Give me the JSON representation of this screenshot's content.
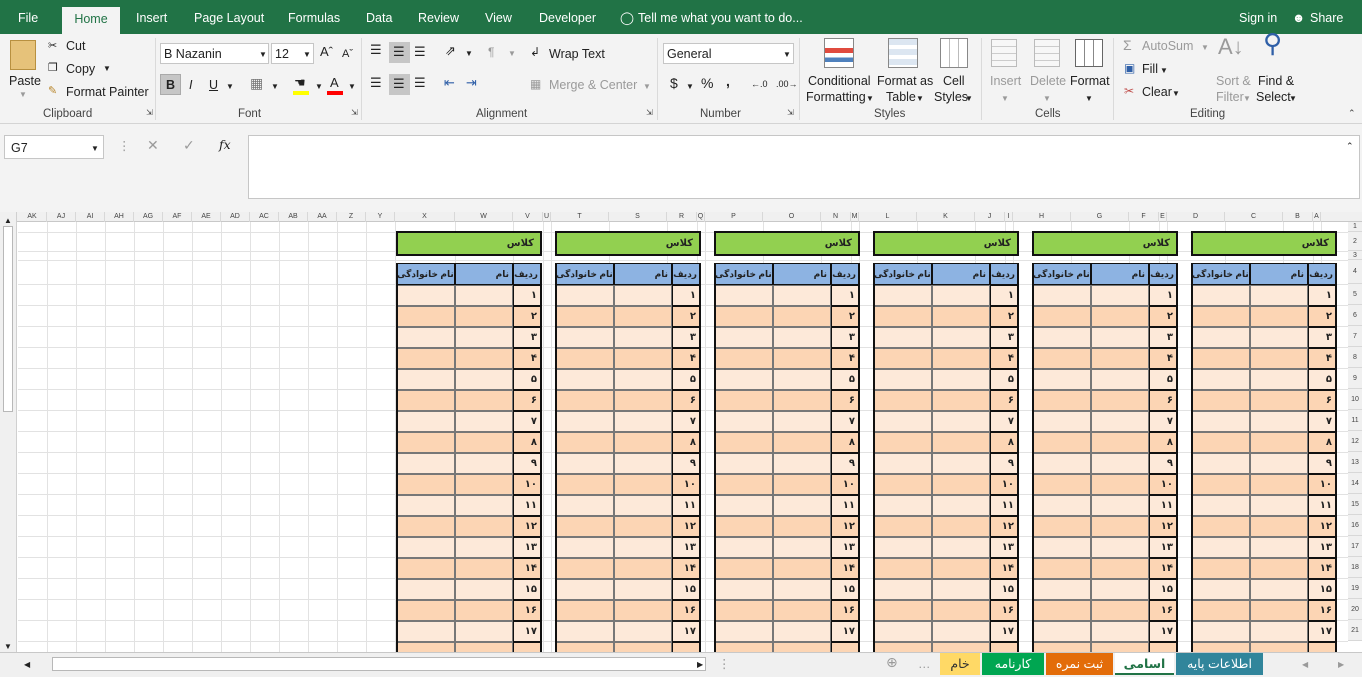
{
  "tabs": [
    "File",
    "Home",
    "Insert",
    "Page Layout",
    "Formulas",
    "Data",
    "Review",
    "View",
    "Developer"
  ],
  "tell_me": "Tell me what you want to do...",
  "signin": "Sign in",
  "share": "Share",
  "clipboard": {
    "paste": "Paste",
    "cut": "Cut",
    "copy": "Copy",
    "format_painter": "Format Painter",
    "label": "Clipboard"
  },
  "font": {
    "name": "B Nazanin",
    "size": "12",
    "bold": "B",
    "italic": "I",
    "underline": "U",
    "label": "Font"
  },
  "alignment": {
    "wrap": "Wrap Text",
    "merge": "Merge & Center",
    "label": "Alignment"
  },
  "number": {
    "format": "General",
    "currency": "$",
    "percent": "%",
    "comma": ",",
    "label": "Number"
  },
  "styles": {
    "cond1": "Conditional",
    "cond2": "Formatting",
    "fmt1": "Format as",
    "fmt2": "Table",
    "cell1": "Cell",
    "cell2": "Styles",
    "label": "Styles"
  },
  "cells": {
    "insert": "Insert",
    "delete": "Delete",
    "format": "Format",
    "label": "Cells"
  },
  "editing": {
    "autosum": "AutoSum",
    "fill": "Fill",
    "clear": "Clear",
    "sort1": "Sort &",
    "sort2": "Filter",
    "find1": "Find &",
    "find2": "Select",
    "label": "Editing"
  },
  "namebox": "G7",
  "fx": "fx",
  "columns": [
    "AK",
    "AJ",
    "AI",
    "AH",
    "AG",
    "AF",
    "AE",
    "AD",
    "AC",
    "AB",
    "AA",
    "Z",
    "Y",
    "X",
    "W",
    "V",
    "U",
    "T",
    "S",
    "R",
    "Q",
    "P",
    "O",
    "N",
    "M",
    "L",
    "K",
    "J",
    "I",
    "H",
    "G",
    "F",
    "E",
    "D",
    "C",
    "B",
    "A"
  ],
  "rows": [
    "1",
    "2",
    "3",
    "4",
    "5",
    "6",
    "7",
    "8",
    "9",
    "10",
    "11",
    "12",
    "13",
    "14",
    "15",
    "16",
    "17",
    "18",
    "19",
    "20",
    "21"
  ],
  "table": {
    "title": "کلاس",
    "h_rank": "ردیف",
    "h_name": "نام",
    "h_family": "نام خانوادگی",
    "nums": [
      "۱",
      "۲",
      "۳",
      "۴",
      "۵",
      "۶",
      "۷",
      "۸",
      "۹",
      "۱۰",
      "۱۱",
      "۱۲",
      "۱۳",
      "۱۴",
      "۱۵",
      "۱۶",
      "۱۷"
    ]
  },
  "sheets": [
    {
      "name": "اطلاعات پایه",
      "color": "#31859b"
    },
    {
      "name": "اسامی",
      "color": "#ffffff"
    },
    {
      "name": "ثبت نمره",
      "color": "#e36c09"
    },
    {
      "name": "کارنامه",
      "color": "#00a651"
    },
    {
      "name": "خام",
      "color": "#ffd966"
    }
  ],
  "colors": {
    "accent": "#217346",
    "title_green": "#92d050",
    "header_blue": "#8db3e2",
    "row_peach": "#fcd5b4",
    "row_light": "#fde9d9"
  }
}
